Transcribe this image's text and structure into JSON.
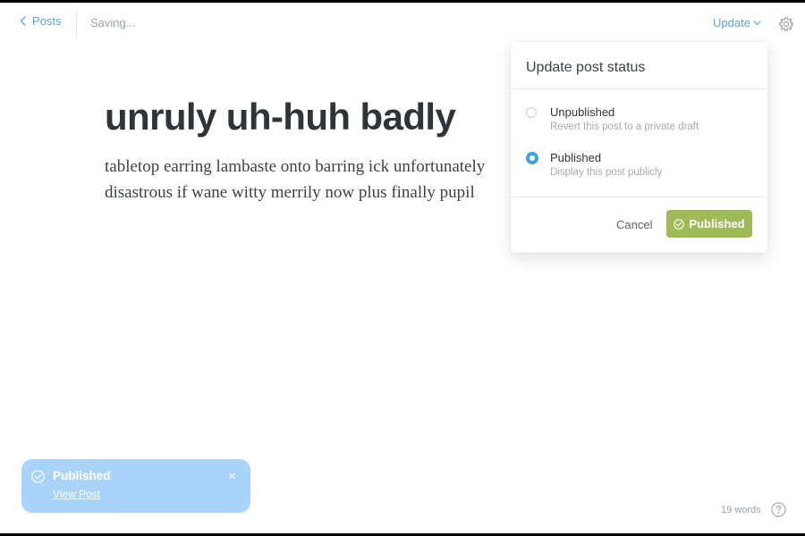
{
  "topbar": {
    "back_label": "Posts",
    "status": "Saving...",
    "update_label": "Update"
  },
  "post": {
    "title": "unruly uh-huh badly",
    "body": "tabletop earring lambaste onto barring ick unfortunately disastrous if wane witty merrily now plus finally pupil"
  },
  "popover": {
    "title": "Update post status",
    "options": [
      {
        "label": "Unpublished",
        "description": "Revert this post to a private draft",
        "selected": false
      },
      {
        "label": "Published",
        "description": "Display this post publicly",
        "selected": true
      }
    ],
    "cancel_label": "Cancel",
    "confirm_label": "Published"
  },
  "toast": {
    "title": "Published",
    "link": "View Post",
    "close_glyph": "×"
  },
  "footer": {
    "word_count": "19 words"
  },
  "colors": {
    "accent": "#5ba4cf",
    "radio_selected": "#3ea1e0",
    "publish_button": "#9fbb58",
    "toast_bg": "#a9d3f8",
    "title_text": "#2e3539"
  },
  "icons": {
    "back": "chevron-left-icon",
    "update": "chevron-down-icon",
    "settings": "gear-icon",
    "confirm": "check-circle-icon",
    "toast": "check-circle-icon",
    "close": "close-icon",
    "help": "question-circle-icon"
  }
}
